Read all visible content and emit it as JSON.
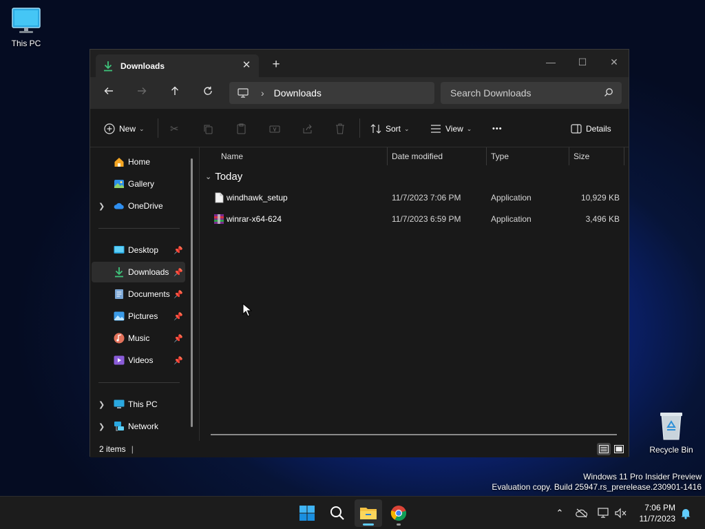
{
  "desktop": {
    "icons": [
      {
        "label": "This PC",
        "icon": "monitor-icon"
      },
      {
        "label": "Recycle Bin",
        "icon": "recycle-bin-icon"
      }
    ],
    "watermark": {
      "line1": "Windows 11 Pro Insider Preview",
      "line2": "Evaluation copy. Build 25947.rs_prerelease.230901-1416"
    }
  },
  "window": {
    "tab": {
      "title": "Downloads",
      "icon": "download-icon",
      "close": "✕"
    },
    "new_tab": "+",
    "controls": {
      "minimize": "—",
      "maximize": "☐",
      "close": "✕"
    },
    "address": {
      "root_icon": "monitor-icon",
      "separator": "›",
      "segment": "Downloads"
    },
    "search": {
      "placeholder": "Search Downloads"
    },
    "command_bar": {
      "new": "New",
      "sort": "Sort",
      "view": "View",
      "more": "•••",
      "details": "Details"
    },
    "sidebar": {
      "quick": [
        {
          "label": "Home",
          "icon": "home-icon",
          "expandable": false,
          "pinned": false
        },
        {
          "label": "Gallery",
          "icon": "gallery-icon",
          "expandable": false,
          "pinned": false
        },
        {
          "label": "OneDrive",
          "icon": "onedrive-icon",
          "expandable": true,
          "pinned": false
        }
      ],
      "pinned": [
        {
          "label": "Desktop",
          "icon": "desktop-icon"
        },
        {
          "label": "Downloads",
          "icon": "download-icon",
          "selected": true
        },
        {
          "label": "Documents",
          "icon": "documents-icon"
        },
        {
          "label": "Pictures",
          "icon": "pictures-icon"
        },
        {
          "label": "Music",
          "icon": "music-icon"
        },
        {
          "label": "Videos",
          "icon": "videos-icon"
        }
      ],
      "locations": [
        {
          "label": "This PC",
          "icon": "monitor-icon"
        },
        {
          "label": "Network",
          "icon": "network-icon"
        }
      ]
    },
    "columns": {
      "name": "Name",
      "date": "Date modified",
      "type": "Type",
      "size": "Size"
    },
    "group": "Today",
    "files": [
      {
        "name": "windhawk_setup",
        "date": "11/7/2023 7:06 PM",
        "type": "Application",
        "size": "10,929 KB",
        "icon": "file-icon"
      },
      {
        "name": "winrar-x64-624",
        "date": "11/7/2023 6:59 PM",
        "type": "Application",
        "size": "3,496 KB",
        "icon": "winrar-icon"
      }
    ],
    "status": {
      "items": "2 items"
    }
  },
  "taskbar": {
    "apps": [
      "start-icon",
      "search-icon",
      "file-explorer-icon",
      "chrome-icon"
    ],
    "clock": {
      "time": "7:06 PM",
      "date": "11/7/2023"
    }
  },
  "colors": {
    "accent": "#60cdff",
    "downloads_green": "#3fc47b",
    "folder_yellow": "#f5c243"
  }
}
